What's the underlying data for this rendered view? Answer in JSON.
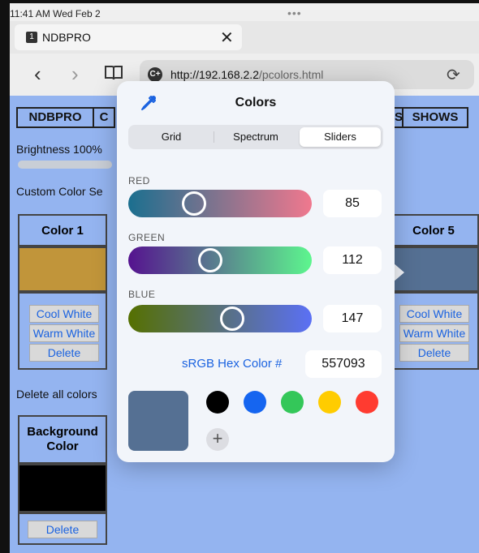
{
  "status_bar": {
    "time": "11:41 AM  Wed Feb 2",
    "dots": "•••"
  },
  "tab": {
    "number": "1",
    "title": "NDBPRO",
    "close": "✕"
  },
  "nav": {
    "back": "‹",
    "forward": "›",
    "reload": "⟳"
  },
  "url": {
    "host": "http://192.168.2.2",
    "path": "/pcolors.html",
    "icon_text": "C+"
  },
  "page": {
    "menu": [
      "NDBPRO",
      "C",
      "S",
      "SHOWS"
    ],
    "brightness": "Brightness 100%",
    "custom_label": "Custom Color Se",
    "color1": {
      "title": "Color 1",
      "swatch": "#c1953a",
      "cool": "Cool White",
      "warm": "Warm White",
      "delete": "Delete"
    },
    "color5": {
      "title": "Color 5",
      "swatch": "#557093",
      "cool": "Cool White",
      "warm": "Warm White",
      "delete": "Delete"
    },
    "delete_all": "Delete all colors",
    "background": {
      "title": "Background Color",
      "swatch": "#000000",
      "delete": "Delete"
    }
  },
  "popover": {
    "title": "Colors",
    "tabs": [
      "Grid",
      "Spectrum",
      "Sliders"
    ],
    "active_tab": "Sliders",
    "sliders": [
      {
        "label": "RED",
        "value": "85",
        "fraction": 0.333
      },
      {
        "label": "GREEN",
        "value": "112",
        "fraction": 0.439
      },
      {
        "label": "BLUE",
        "value": "147",
        "fraction": 0.576
      }
    ],
    "hex_label": "sRGB Hex Color #",
    "hex_value": "557093",
    "current_color": "#557093",
    "palette": [
      "#000000",
      "#1565f0",
      "#34c759",
      "#ffcc00",
      "#ff3b30"
    ],
    "add": "+"
  },
  "colors": {
    "page_bg": "#94b4f0",
    "link_blue": "#1a62e0"
  }
}
